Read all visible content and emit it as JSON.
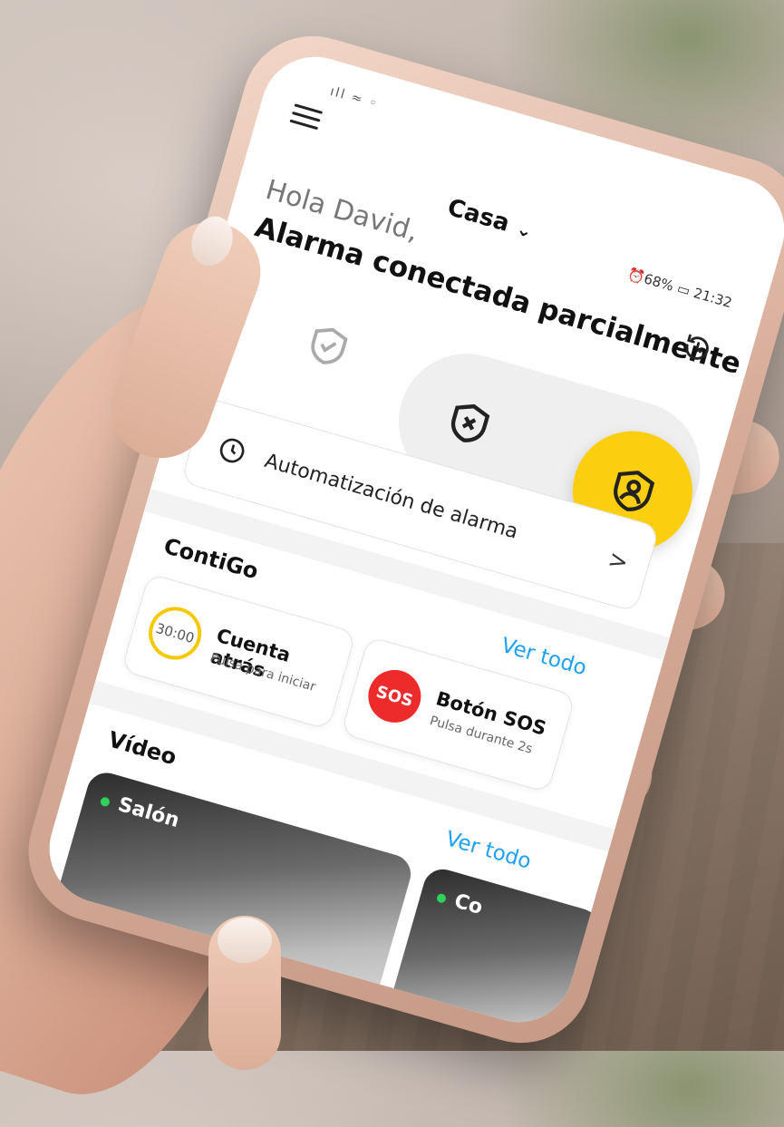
{
  "status_bar": {
    "signal": "ıll ≈ ◦",
    "right": "⏰68% ▭ 21:32"
  },
  "header": {
    "home_name": "Casa",
    "chevron": "⌄"
  },
  "greeting": "Hola David,",
  "alarm": {
    "status": "Alarma  conectada parcialmente",
    "automation_label": "Automatización de alarma",
    "automation_arrow": ">"
  },
  "contigo": {
    "title": "ContiGo",
    "see_all": "Ver todo",
    "cards": [
      {
        "badge": "30:00",
        "title": "Cuenta atrás",
        "subtitle": "Pulsa para iniciar"
      },
      {
        "badge": "SOS",
        "title": "Botón SOS",
        "subtitle": "Pulsa durante 2s"
      }
    ]
  },
  "video": {
    "title": "Vídeo",
    "see_all": "Ver todo",
    "cameras": [
      {
        "name": "Salón"
      },
      {
        "name": "Co"
      }
    ]
  },
  "colors": {
    "accent_yellow": "#fbcf0f",
    "link_blue": "#1da1f2",
    "sos_red": "#ee2b2b",
    "online_green": "#2fd158"
  }
}
